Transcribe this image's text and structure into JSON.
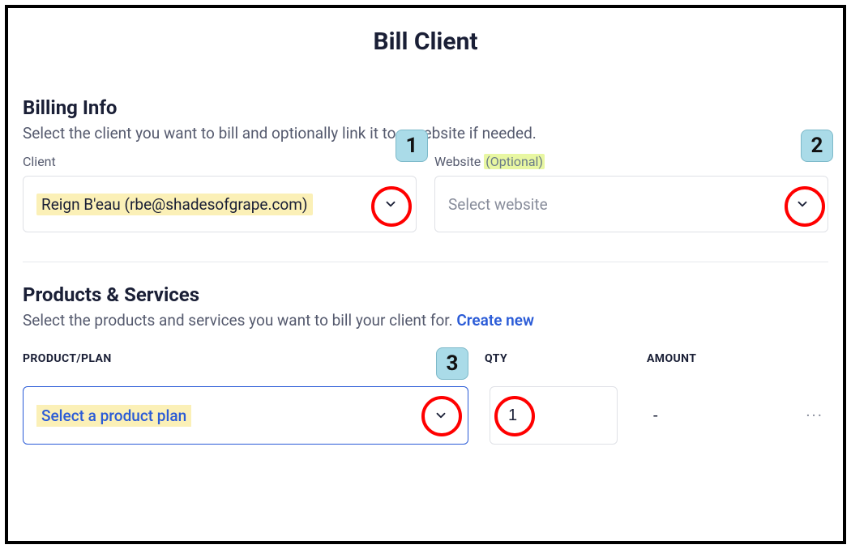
{
  "page": {
    "title": "Bill Client"
  },
  "billing": {
    "title": "Billing Info",
    "desc": "Select the client you want to bill and optionally link it to a website if needed.",
    "client_label": "Client",
    "client_value": "Reign B'eau (rbe@shadesofgrape.com)",
    "website_label": "Website",
    "website_optional": "(Optional)",
    "website_placeholder": "Select website"
  },
  "products": {
    "title": "Products & Services",
    "desc_prefix": "Select the products and services you want to bill your client for. ",
    "create_new": "Create new",
    "headers": {
      "product": "PRODUCT/PLAN",
      "qty": "QTY",
      "amount": "AMOUNT"
    },
    "row": {
      "plan_placeholder": "Select a product plan",
      "qty": "1",
      "amount": "-",
      "more": "···"
    }
  },
  "markers": {
    "m1": "1",
    "m2": "2",
    "m3": "3"
  }
}
